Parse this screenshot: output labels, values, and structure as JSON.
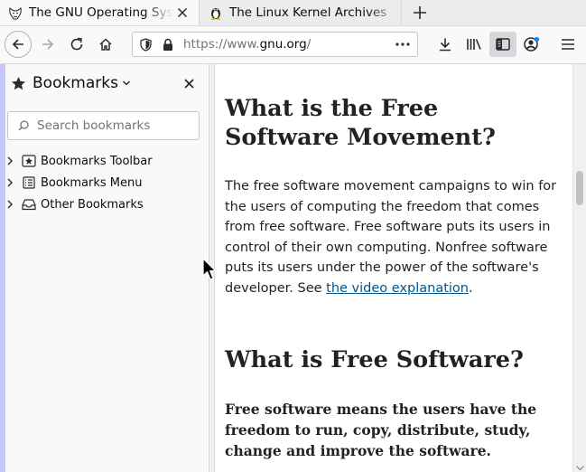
{
  "browser": {
    "tabs": [
      {
        "title": "The GNU Operating System and the Free Software Movement",
        "favicon": "gnu-head-icon",
        "active": true
      },
      {
        "title": "The Linux Kernel Archives",
        "favicon": "tux-penguin-icon",
        "active": false
      }
    ],
    "new_tab_icon": "plus-icon",
    "nav": {
      "back_icon": "arrow-left-icon",
      "forward_icon": "arrow-right-icon",
      "reload_icon": "reload-icon",
      "home_icon": "home-icon"
    },
    "url": {
      "scheme": "https://www.",
      "host": "gnu.org",
      "path": "/",
      "page_actions_icon": "ellipsis-icon"
    },
    "toolbar_right": [
      "download-icon",
      "library-icon",
      "sidebar-icon",
      "account-icon",
      "menu-icon"
    ]
  },
  "sidebar": {
    "title": "Bookmarks",
    "title_icon": "star-icon",
    "close_icon": "close-icon",
    "search_placeholder": "Search bookmarks",
    "items": [
      {
        "label": "Bookmarks Toolbar",
        "icon": "bookmarks-toolbar-icon"
      },
      {
        "label": "Bookmarks Menu",
        "icon": "bookmarks-menu-icon"
      },
      {
        "label": "Other Bookmarks",
        "icon": "other-bookmarks-icon"
      }
    ]
  },
  "page": {
    "heading1": "What is the Free Software Movement?",
    "para1_text": "The free software movement campaigns to win for the users of computing the freedom that comes from free software. Free software puts its users in control of their own computing. Nonfree software puts its users under the power of the software's developer. See ",
    "para1_link": "the video explanation",
    "para1_end": ".",
    "heading2": "What is Free Software?",
    "para2": "Free software means the users have the freedom to run, copy, distribute, study, change and improve the software."
  },
  "colors": {
    "accent": "#0a84ff",
    "link": "#005689",
    "sidebar_bg": "#f9f9fa",
    "sidebar_accent": "#c5c5ff"
  }
}
